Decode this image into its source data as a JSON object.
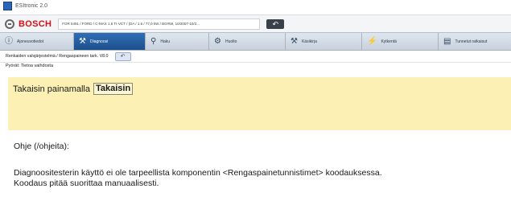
{
  "window": {
    "title": "ESItronic 2.0"
  },
  "brand": {
    "name": "BOSCH",
    "vehicle": "FOR 5491 / FORD / C-MAX 1.6 TI-VCT / (DA / 1.6 / 77,0 kW / BG#59, 10/2007-10/2..."
  },
  "nav": {
    "tabs": [
      {
        "label": "Ajoneuvotiedot",
        "icon": "info-icon"
      },
      {
        "label": "Diagnoosi",
        "icon": "diagnosis-icon"
      },
      {
        "label": "Haku",
        "icon": "search-icon"
      },
      {
        "label": "Huolto",
        "icon": "service-icon"
      },
      {
        "label": "Käsikirja",
        "icon": "wrench-icon"
      },
      {
        "label": "Kytkentä",
        "icon": "wiring-icon"
      },
      {
        "label": "Tunnetut ratkaisut",
        "icon": "solutions-icon"
      }
    ],
    "active_tab": "Diagnoosi"
  },
  "breadcrumb": "Renkaiden valvjärjestelmä / Rengaspaineen tark. V8.0",
  "status_line": "Pyörät: Tietoa vaihdosta",
  "message": {
    "text": "Takaisin painamalla",
    "button_label": "Takaisin"
  },
  "help": {
    "heading": "Ohje (/ohjeita):",
    "line1": "Diagnoositesterin käyttö ei ole tarpeellista komponentin <Rengaspainetunnistimet> koodauksessa.",
    "line2": "Koodaus pitää suorittaa manuaalisesti."
  },
  "colors": {
    "brand_red": "#d30f17",
    "active_tab": "#2f6fb6",
    "message_bg": "#fdf0b5"
  }
}
